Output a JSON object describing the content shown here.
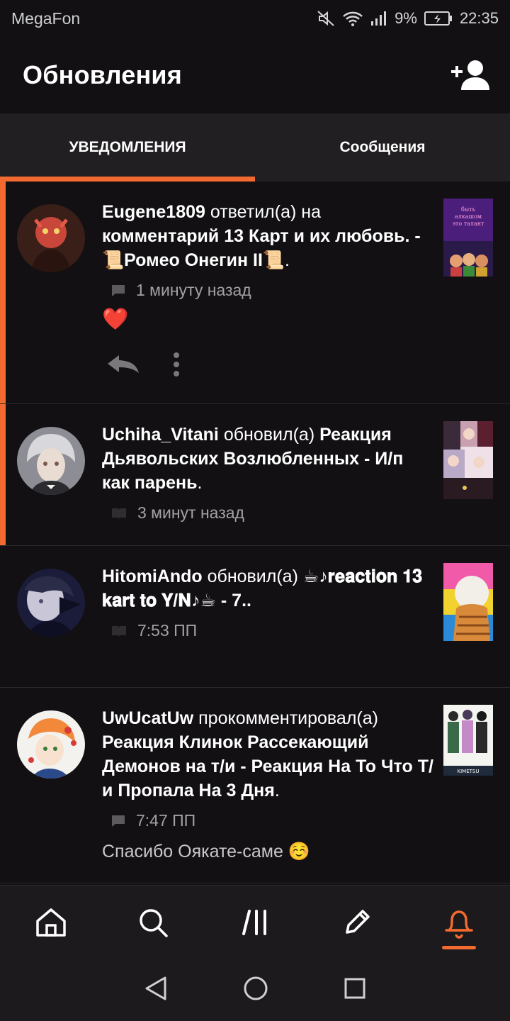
{
  "status_bar": {
    "carrier": "MegaFon",
    "battery": "9%",
    "time": "22:35"
  },
  "header": {
    "title": "Обновления",
    "add_friend_icon": "add-user-icon"
  },
  "tabs": [
    {
      "label": "УВЕДОМЛЕНИЯ",
      "active": true
    },
    {
      "label": "Сообщения",
      "active": false
    }
  ],
  "notifications": [
    {
      "user": "Eugene1809",
      "action": "ответил(а) на",
      "target": "комментарий 13 Карт и их любовь. - 📜Ромео Онегин II📜",
      "tail": ".",
      "time": "1 минуту назад",
      "meta_icon": "comment-icon",
      "note": "❤️",
      "unread": true
    },
    {
      "user": "Uchiha_Vitani",
      "action": "обновил(а)",
      "target": "Реакция Дьявольских Возлюбленных - И/п как парень",
      "tail": ".",
      "time": "3 минут назад",
      "meta_icon": "book-icon",
      "unread": true
    },
    {
      "user": "HitomiAndo",
      "action": "обновил(а)",
      "target": "☕♪𝐫𝐞𝐚𝐜𝐭𝐢𝐨𝐧 𝟏𝟑 𝐤𝐚𝐫𝐭 𝐭𝐨 𝐘/𝐍♪☕ - 7..",
      "tail": "",
      "time": "7:53 ПП",
      "meta_icon": "book-icon",
      "unread": false
    },
    {
      "user": "UwUcatUw",
      "action": "прокомментировал(а)",
      "target": "Реакция Клинок Рассекающий Демонов на т/и - Реакция На То Что Т/и Пропала На 3 Дня",
      "tail": ".",
      "time": "7:47 ПП",
      "meta_icon": "comment-icon",
      "note": "Спасибо Оякате-саме ☺️",
      "unread": false
    }
  ],
  "thumb_texts": {
    "first": "быть алкашом это талант",
    "fourth": "KIMETSU"
  },
  "bottom_nav": [
    {
      "name": "home-icon",
      "active": false
    },
    {
      "name": "search-icon",
      "active": false
    },
    {
      "name": "library-icon",
      "active": false
    },
    {
      "name": "write-icon",
      "active": false
    },
    {
      "name": "bell-icon",
      "active": true
    }
  ],
  "colors": {
    "accent": "#f26a2f",
    "background": "#121013",
    "tab_bar": "#221f22"
  }
}
